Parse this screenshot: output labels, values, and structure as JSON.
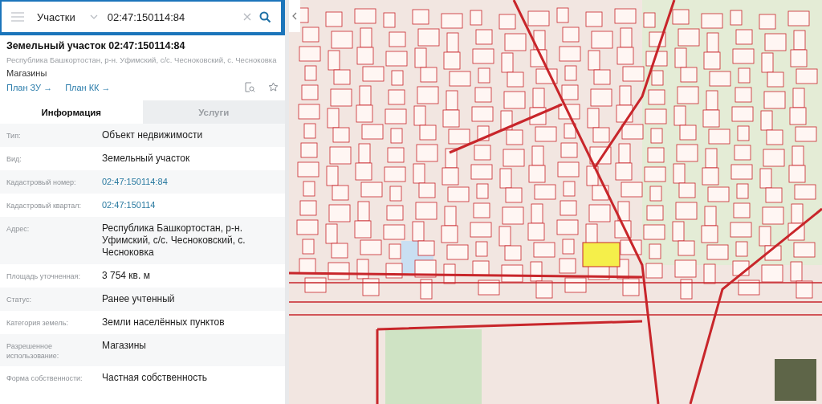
{
  "search": {
    "category": "Участки",
    "value": "02:47:150114:84"
  },
  "object": {
    "title": "Земельный участок 02:47:150114:84",
    "address": "Республика Башкортостан, р-н. Уфимский, с/с. Чесноковский, с. Чесноковка",
    "use": "Магазины",
    "links": [
      "План ЗУ →",
      "План КК →"
    ]
  },
  "tabs": [
    {
      "label": "Информация",
      "selected": true
    },
    {
      "label": "Услуги",
      "selected": false
    }
  ],
  "properties": [
    {
      "label": "Тип:",
      "value": "Объект недвижимости",
      "kind": "text"
    },
    {
      "label": "Вид:",
      "value": "Земельный участок",
      "kind": "text"
    },
    {
      "label": "Кадастровый номер:",
      "value": "02:47:150114:84",
      "kind": "link"
    },
    {
      "label": "Кадастровый квартал:",
      "value": "02:47:150114",
      "kind": "link"
    },
    {
      "label": "Адрес:",
      "value": "Республика Башкортостан, р-н. Уфимский, с/с. Чесноковский, с. Чесноковка",
      "kind": "text"
    },
    {
      "label": "Площадь уточненная:",
      "value": "3 754 кв. м",
      "kind": "text"
    },
    {
      "label": "Статус:",
      "value": "Ранее учтенный",
      "kind": "text"
    },
    {
      "label": "Категория земель:",
      "value": "Земли населённых пунктов",
      "kind": "text"
    },
    {
      "label": "Разрешенное использование:",
      "value": "Магазины",
      "kind": "text"
    },
    {
      "label": "Форма собственности:",
      "value": "Частная собственность",
      "kind": "text"
    }
  ]
}
